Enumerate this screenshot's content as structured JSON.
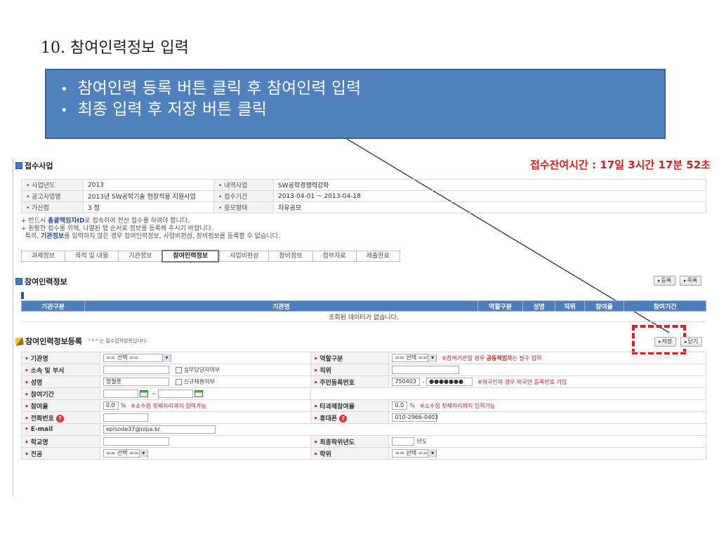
{
  "slide_title": "10. 참여인력정보 입력",
  "callout": {
    "bullets": [
      "참여인력 등록 버튼 클릭 후 참여인력 입력",
      "최종 입력 후 저장 버튼 클릭"
    ]
  },
  "section_title": "접수사업",
  "timer": "접수잔여시간 : 17일 3시간 17분 52초",
  "business_info": {
    "r1": {
      "l1": "사업년도",
      "v1": "2013",
      "l2": "내역사업",
      "v2": "SW공학경쟁력강화"
    },
    "r2": {
      "l1": "공고사업명",
      "v1": "2013년 SW공학기술 현장적용 지원사업",
      "l2": "접수기간",
      "v2": "2013-04-01 ~ 2013-04-18"
    },
    "r3": {
      "l1": "가산점",
      "v1": "3 점",
      "l2": "응모형태",
      "v2": "자유공모"
    }
  },
  "notes": {
    "n1_pre": "반드시 ",
    "n1_bold": "총괄책임자ID",
    "n1_post": "로 접속하여 전산 접수를 하여야 합니다.",
    "n2": "원활한 접수를 위해, 나열된 탭 순서로 정보를 등록해 주시기 바랍니다.",
    "n3_pre": "특히, ",
    "n3_bold": "기관정보",
    "n3_post": "를 입력하지 않은 경우 참여인력정보, 사업비편성, 장비정보를 등록할 수 없습니다."
  },
  "tabs": [
    "과제정보",
    "목적 및 내용",
    "기관정보",
    "참여인력정보",
    "사업비편성",
    "장비정보",
    "첨부자료",
    "제출완료"
  ],
  "participant_section": {
    "title": "참여인력정보",
    "register_btn": "등록",
    "list_btn": "목록",
    "headers": [
      "기관구분",
      "기관명",
      "역할구분",
      "성명",
      "직위",
      "참여율",
      "참여기간"
    ],
    "empty_text": "조회된 데이터가 없습니다."
  },
  "form_section": {
    "title": "참여인력정보등록",
    "required_note_star": "\" * \"",
    "required_note": " 는 필수입력항목입니다.",
    "save_btn": "저장",
    "close_btn": "닫기"
  },
  "form": {
    "org_name": {
      "label": "기관명",
      "value": "== 선택 =="
    },
    "role": {
      "label": "역할구분",
      "value": "== 선택 ==",
      "warn_pre": "※참여기관일 경우 ",
      "warn_bold": "공동책임자",
      "warn_post": "는 필수 입력"
    },
    "dept": {
      "label": "소속 및 부서",
      "checkbox": "실무담당자여부"
    },
    "position": {
      "label": "직위"
    },
    "name": {
      "label": "성명",
      "value": "정철훈",
      "checkbox": "신규채용여부"
    },
    "rrn": {
      "label": "주민등록번호",
      "front": "750403",
      "dash": "-",
      "back": "●●●●●●●",
      "warn": "※외국인의 경우 외국인 등록번호 기입"
    },
    "period": {
      "label": "참여기간",
      "sep": "~"
    },
    "rate": {
      "label": "참여율",
      "value": "0.0",
      "unit": "%",
      "warn": "※소수점 첫째자리까지 입력가능"
    },
    "other_rate": {
      "label": "타과제참여율",
      "value": "0.0",
      "unit": "%",
      "warn": "※소수점 첫째자리까지 입력가능"
    },
    "phone": {
      "label": "전화번호"
    },
    "mobile": {
      "label": "휴대폰",
      "value": "010-2966-0403"
    },
    "email": {
      "label": "E-mail",
      "value": "episode37@nipa.kr"
    },
    "school": {
      "label": "학교명"
    },
    "grad_year": {
      "label": "최종학위년도",
      "unit": "년도"
    },
    "major": {
      "label": "전공",
      "value": "== 선택 =="
    },
    "degree": {
      "label": "학위",
      "value": "== 선택 =="
    }
  },
  "colors": {
    "callout": "#4f81bd",
    "header": "#4d7fc0",
    "highlight": "#e02020",
    "timer": "#e02020"
  }
}
